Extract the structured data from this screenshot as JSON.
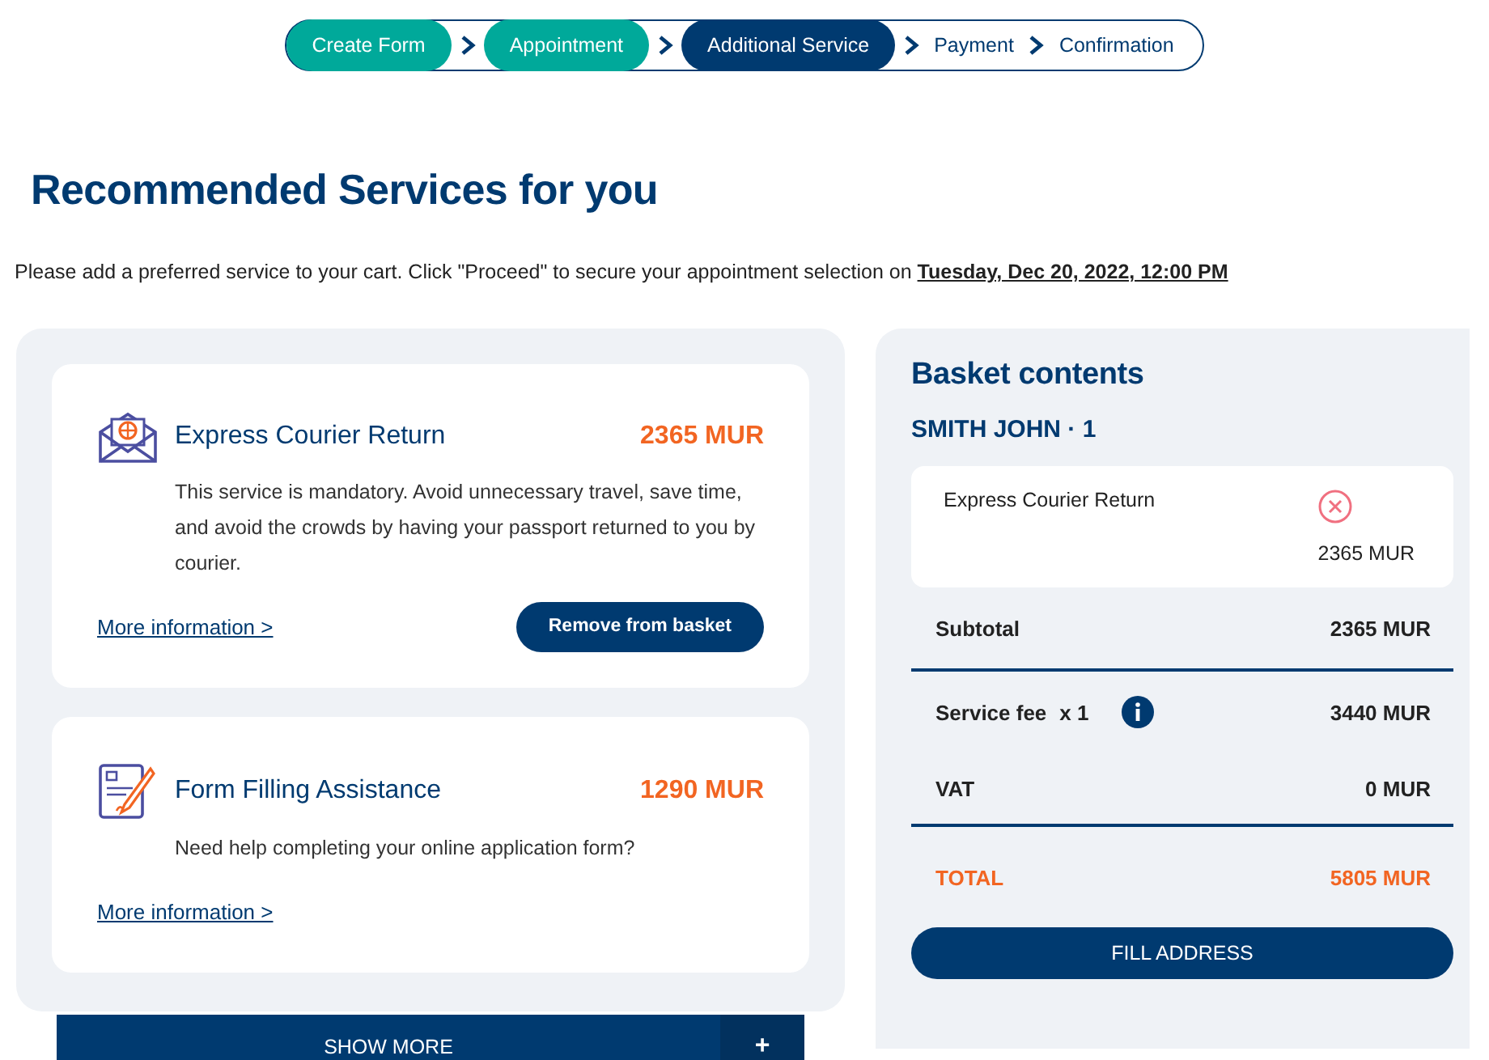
{
  "steps": [
    {
      "label": "Create Form",
      "completed": true,
      "selected": false
    },
    {
      "label": "Appointment",
      "completed": true,
      "selected": false
    },
    {
      "label": "Additional Service",
      "completed": false,
      "selected": true
    },
    {
      "label": "Payment",
      "completed": false,
      "selected": false
    },
    {
      "label": "Confirmation",
      "completed": false,
      "selected": false
    }
  ],
  "heading": "Recommended Services for you",
  "intro": {
    "text": "Please add a preferred service to your cart. Click \"Proceed\" to secure your appointment selection on",
    "date": "Tuesday, Dec 20, 2022, 12:00 PM"
  },
  "services": [
    {
      "kind": "courier",
      "name": "Express Courier Return",
      "price": "2365 MUR",
      "description": "This service is mandatory. Avoid unnecessary travel, save time, and avoid the crowds by having your passport returned to you by courier.",
      "link": "More information >",
      "button": "Remove from basket"
    },
    {
      "kind": "form",
      "name": "Form Filling Assistance",
      "price": "1290 MUR",
      "description": "Need help completing your online application form?",
      "link": "More information >"
    }
  ],
  "show_more": {
    "label": "SHOW MORE",
    "icon": "+"
  },
  "basket": {
    "title": "Basket contents",
    "person": "SMITH JOHN · 1",
    "items": [
      {
        "name": "Express Courier Return",
        "price": "2365 MUR"
      }
    ],
    "subtotal": {
      "label": "Subtotal",
      "value": "2365 MUR"
    },
    "service_fee": {
      "label": "Service fee",
      "count": "x 1",
      "value": "3440 MUR"
    },
    "vat": {
      "label": "VAT",
      "value": "0 MUR"
    },
    "total": {
      "label": "TOTAL",
      "value": "5805 MUR"
    },
    "button": "FILL ADDRESS"
  }
}
